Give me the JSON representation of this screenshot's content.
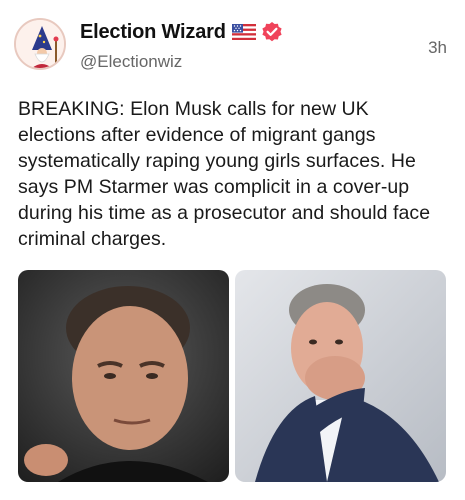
{
  "post": {
    "author": {
      "display_name": "Election Wizard",
      "handle": "@Electionwiz",
      "flag_icon": "us-flag-icon",
      "verified_icon": "verified-badge-icon",
      "avatar_icon": "wizard-avatar-icon"
    },
    "timestamp": "3h",
    "text": "BREAKING: Elon Musk calls for new UK elections after evidence of migrant gangs systematically raping young girls surfaces. He says PM Starmer was complicit in a cover-up during his time as a prosecutor and should face criminal charges.",
    "media": [
      {
        "kind": "photo"
      },
      {
        "kind": "photo"
      }
    ]
  },
  "colors": {
    "verified_badge": "#f0435a",
    "handle_gray": "#666666",
    "text": "#1a1a1a"
  }
}
